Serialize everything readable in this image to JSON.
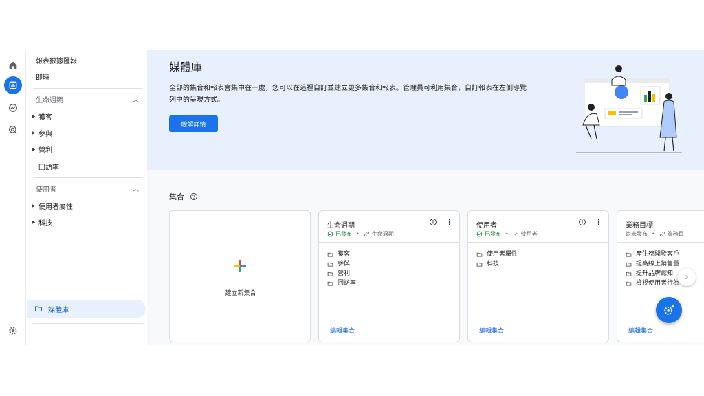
{
  "nav": {
    "top_items": [
      "報表數據匯報",
      "即時"
    ],
    "sections": [
      {
        "title": "生命週期",
        "items": [
          {
            "label": "獲客",
            "expandable": true
          },
          {
            "label": "參與",
            "expandable": true
          },
          {
            "label": "營利",
            "expandable": true
          },
          {
            "label": "回訪率",
            "expandable": false
          }
        ]
      },
      {
        "title": "使用者",
        "items": [
          {
            "label": "使用者屬性",
            "expandable": true
          },
          {
            "label": "科技",
            "expandable": true
          }
        ]
      }
    ],
    "library_label": "媒體庫"
  },
  "banner": {
    "title": "媒體庫",
    "description": "全部的集合和報表會集中在一處，您可以在這裡自訂並建立更多集合和報表。管理員可利用集合，自訂報表在左側導覽列中的呈現方式。",
    "learn_more": "瞭解詳情"
  },
  "collections": {
    "section_title": "集合",
    "new_label": "建立新集合",
    "cards": [
      {
        "title": "生命週期",
        "status": "已發布",
        "link": "生命週期",
        "items": [
          "獲客",
          "參與",
          "營利",
          "回訪率"
        ],
        "edit": "編輯集合"
      },
      {
        "title": "使用者",
        "status": "已發布",
        "link": "使用者",
        "items": [
          "使用者屬性",
          "科技"
        ],
        "edit": "編輯集合"
      },
      {
        "title": "業務目標",
        "status": "尚未發布",
        "link": "業務目",
        "items": [
          "產生待開發客戶",
          "提高線上銷售量",
          "提升品牌認知",
          "檢視使用者行為"
        ],
        "edit": "編輯集合"
      }
    ]
  },
  "colors": {
    "accent": "#1a73e8",
    "banner_bg": "#e8f0fe",
    "published": "#188038"
  },
  "icons": [
    "home-icon",
    "reports-icon",
    "explore-icon",
    "advertising-icon",
    "settings-icon",
    "folder-icon",
    "help-icon",
    "info-icon",
    "more-vert-icon",
    "chevron-right-icon",
    "chevron-left-icon",
    "customize-fab-icon"
  ]
}
